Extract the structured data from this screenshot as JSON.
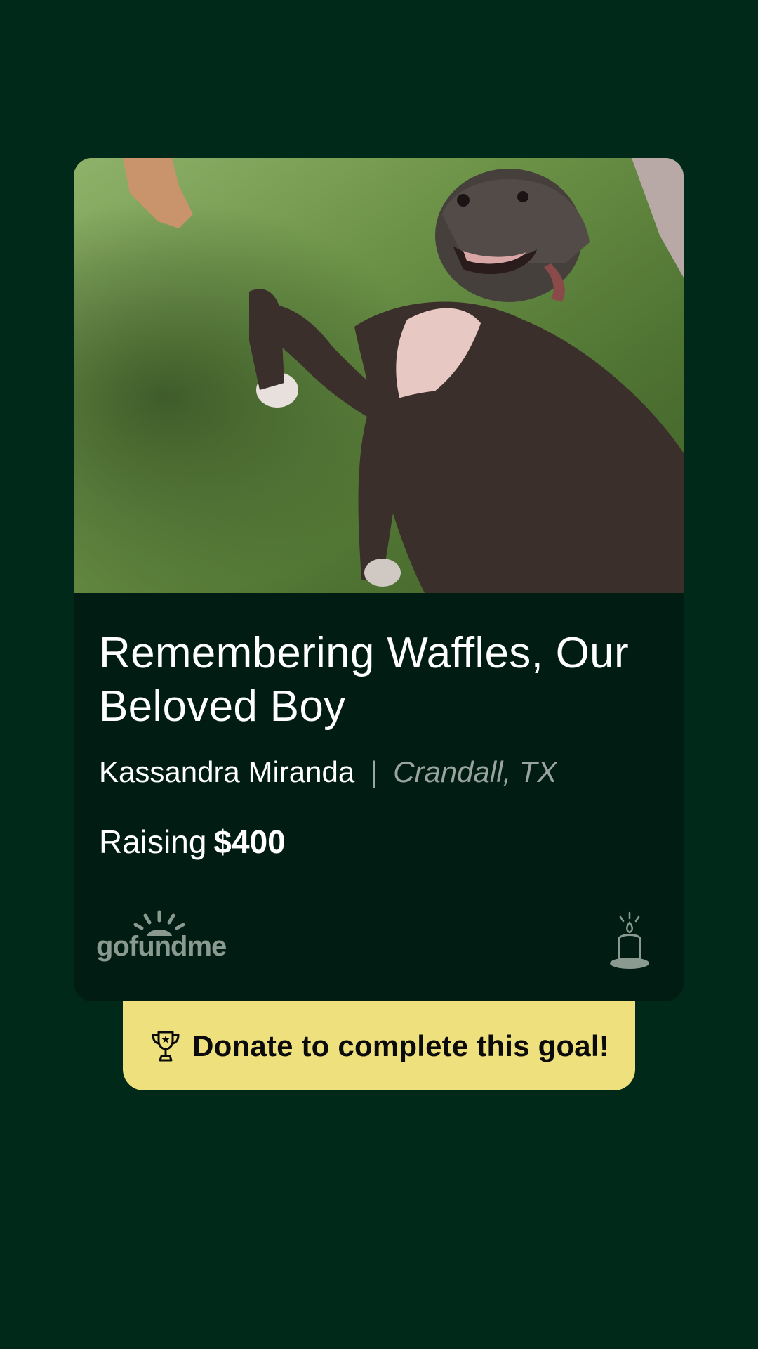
{
  "campaign": {
    "title": "Remembering Waffles, Our Beloved Boy",
    "organizer": "Kassandra Miranda",
    "separator": "|",
    "location": "Crandall, TX",
    "raising_label": "Raising",
    "goal_amount": "$400"
  },
  "brand": {
    "logo_text": "gofundme",
    "logo_color": "#8a9a90"
  },
  "cta": {
    "label": "Donate to complete this goal!"
  },
  "icons": {
    "logo": "gofundme-logo",
    "candle": "candle-icon",
    "trophy": "trophy-icon"
  },
  "colors": {
    "background": "#01291a",
    "card": "#011d13",
    "cta_background": "#eee07d",
    "cta_text": "#0b0b0b"
  }
}
